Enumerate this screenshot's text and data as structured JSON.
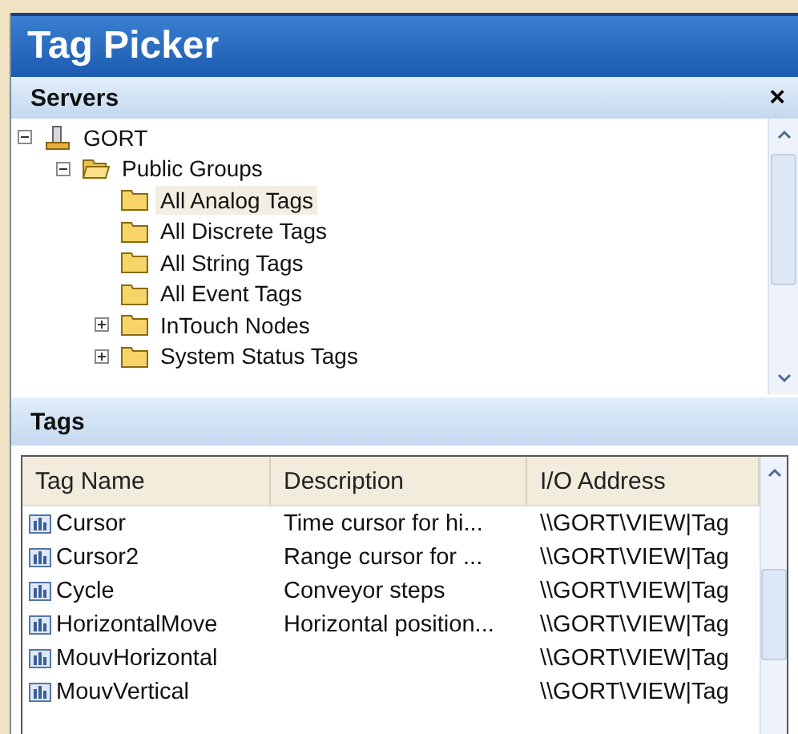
{
  "window": {
    "title": "Tag Picker"
  },
  "servers": {
    "title": "Servers",
    "close": "×",
    "tree": [
      {
        "label": "GORT",
        "kind": "server",
        "expanded": true,
        "selected": false,
        "children": [
          {
            "label": "Public Groups",
            "kind": "folder",
            "expanded": true,
            "selected": false,
            "children": [
              {
                "label": "All Analog Tags",
                "kind": "folder",
                "selected": true
              },
              {
                "label": "All Discrete Tags",
                "kind": "folder",
                "selected": false
              },
              {
                "label": "All String Tags",
                "kind": "folder",
                "selected": false
              },
              {
                "label": "All Event Tags",
                "kind": "folder",
                "selected": false
              },
              {
                "label": "InTouch Nodes",
                "kind": "folder",
                "expanded": false,
                "selected": false
              },
              {
                "label": "System Status Tags",
                "kind": "folder",
                "expanded": false,
                "selected": false
              }
            ]
          }
        ]
      }
    ]
  },
  "tags": {
    "title": "Tags",
    "columns": [
      "Tag Name",
      "Description",
      "I/O Address"
    ],
    "rows": [
      {
        "name": "Cursor",
        "description": "Time cursor for hi...",
        "address": "\\\\GORT\\VIEW|Tag"
      },
      {
        "name": "Cursor2",
        "description": "Range cursor for ...",
        "address": "\\\\GORT\\VIEW|Tag"
      },
      {
        "name": "Cycle",
        "description": "Conveyor steps",
        "address": "\\\\GORT\\VIEW|Tag"
      },
      {
        "name": "HorizontalMove",
        "description": "Horizontal position...",
        "address": "\\\\GORT\\VIEW|Tag"
      },
      {
        "name": "MouvHorizontal",
        "description": "",
        "address": "\\\\GORT\\VIEW|Tag"
      },
      {
        "name": "MouvVertical",
        "description": "",
        "address": "\\\\GORT\\VIEW|Tag"
      }
    ]
  }
}
